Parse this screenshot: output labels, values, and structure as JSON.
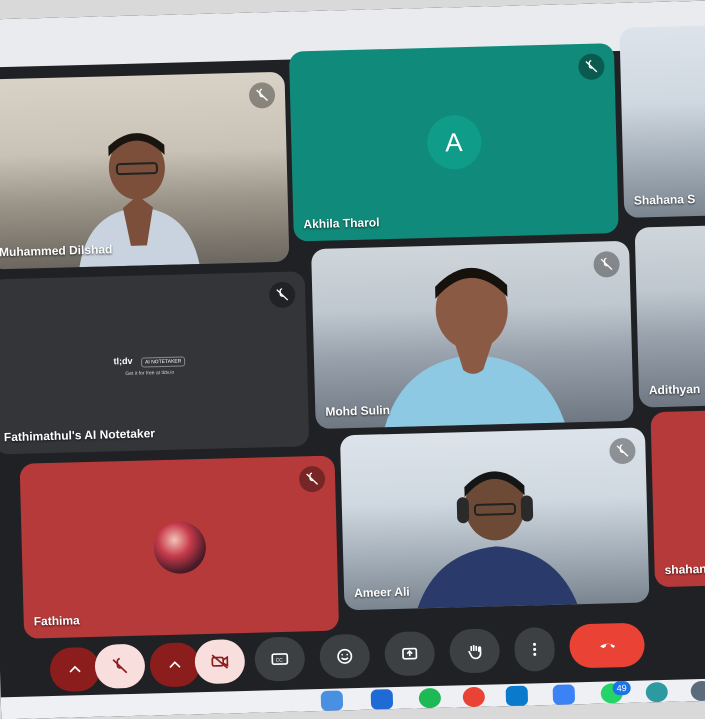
{
  "participants": [
    {
      "name": "Muhammed Dilshad",
      "muted": true,
      "type": "video"
    },
    {
      "name": "Akhila Tharol",
      "muted": true,
      "type": "initial",
      "initial": "A"
    },
    {
      "name": "Shahana S",
      "muted": false,
      "type": "video"
    },
    {
      "name": "Fathimathul's AI Notetaker",
      "muted": true,
      "type": "notetaker"
    },
    {
      "name": "Mohd Sulin",
      "muted": true,
      "type": "video"
    },
    {
      "name": "Adithyan",
      "muted": false,
      "type": "video"
    },
    {
      "name": "Fathima",
      "muted": true,
      "type": "photo"
    },
    {
      "name": "Ameer Ali",
      "muted": true,
      "type": "video"
    },
    {
      "name": "shahan",
      "muted": false,
      "type": "video"
    }
  ],
  "notetaker": {
    "logo": "tl;dv",
    "badge": "AI NOTETAKER",
    "sub": "Get it for free at tldv.io"
  },
  "controls": {
    "mic_state": "off",
    "camera_state": "off"
  },
  "taskbar": {
    "whatsapp_badge": "49"
  },
  "colors": {
    "background": "#1f2124",
    "tile": "#333539",
    "akhila_tile": "#108a7a",
    "fathima_tile": "#b73a3a",
    "end_call": "#ea4335"
  }
}
